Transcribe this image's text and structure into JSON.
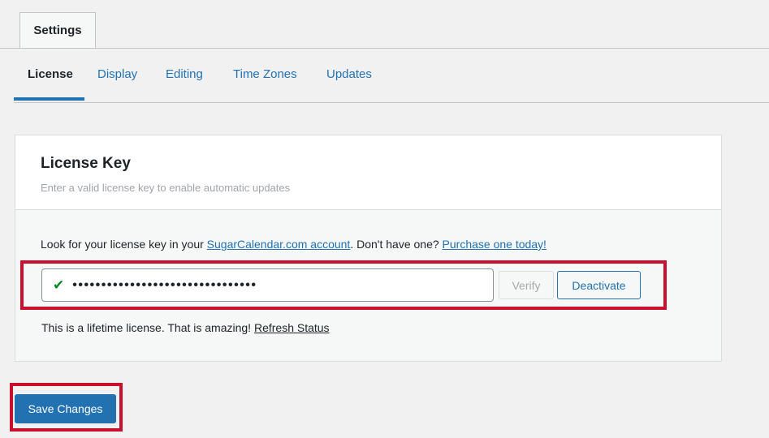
{
  "header": {
    "settings_tab": "Settings"
  },
  "tabs": [
    {
      "label": "License",
      "active": true
    },
    {
      "label": "Display",
      "active": false
    },
    {
      "label": "Editing",
      "active": false
    },
    {
      "label": "Time Zones",
      "active": false
    },
    {
      "label": "Updates",
      "active": false
    }
  ],
  "license": {
    "title": "License Key",
    "description": "Enter a valid license key to enable automatic updates",
    "help_prefix": "Look for your license key in your ",
    "account_link": "SugarCalendar.com account",
    "help_middle": ". Don't have one? ",
    "purchase_link": "Purchase one today!",
    "key_masked": "••••••••••••••••••••••••••••••••",
    "valid_icon": "checkmark-icon",
    "verify_label": "Verify",
    "deactivate_label": "Deactivate",
    "status_text": "This is a lifetime license. That is amazing! ",
    "refresh_link": "Refresh Status"
  },
  "footer": {
    "save_label": "Save Changes"
  },
  "colors": {
    "accent": "#2271b1",
    "valid": "#008a20",
    "highlight": "#c8102e"
  }
}
